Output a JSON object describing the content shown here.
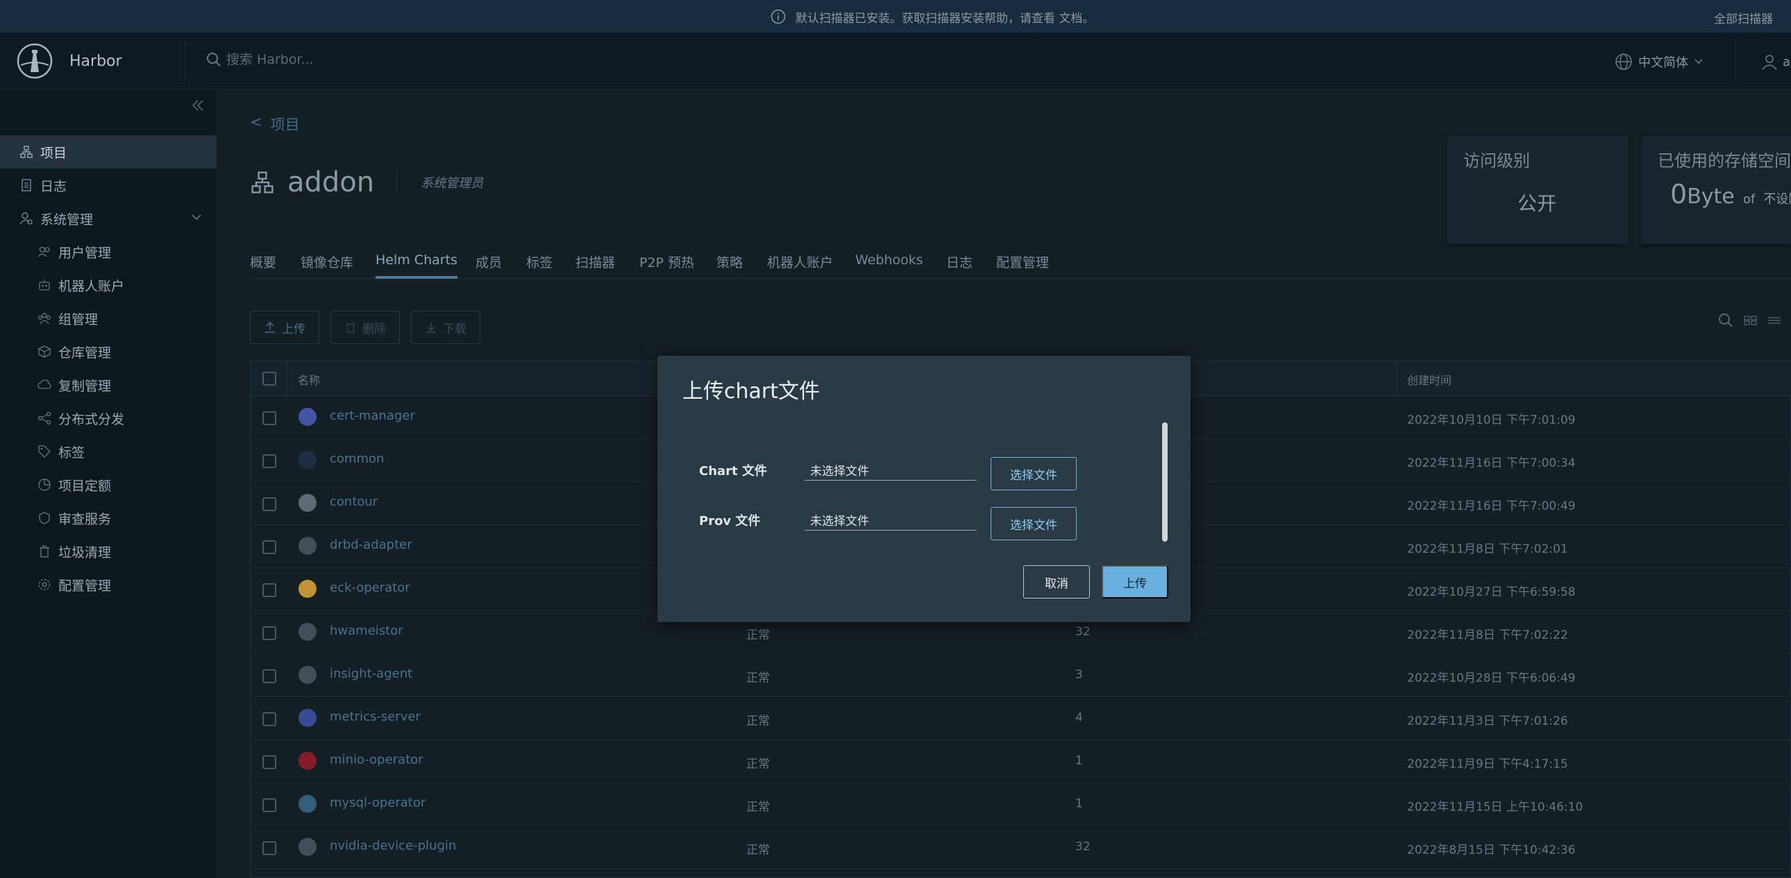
{
  "banner": {
    "message": "默认扫描器已安装。获取扫描器安装帮助，请查看 文档。",
    "action": "全部扫描器"
  },
  "header": {
    "brand": "Harbor",
    "search_placeholder": "搜索 Harbor...",
    "language": "中文简体",
    "user": "ad"
  },
  "sidebar": {
    "items": [
      {
        "label": "项目",
        "icon": "project-icon"
      },
      {
        "label": "日志",
        "icon": "log-icon"
      },
      {
        "label": "系统管理",
        "icon": "admin-icon"
      },
      {
        "label": "用户管理",
        "icon": "users-icon"
      },
      {
        "label": "机器人账户",
        "icon": "robot-icon"
      },
      {
        "label": "组管理",
        "icon": "group-icon"
      },
      {
        "label": "仓库管理",
        "icon": "registry-icon"
      },
      {
        "label": "复制管理",
        "icon": "replication-icon"
      },
      {
        "label": "分布式分发",
        "icon": "distribution-icon"
      },
      {
        "label": "标签",
        "icon": "tag-icon"
      },
      {
        "label": "项目定额",
        "icon": "quota-icon"
      },
      {
        "label": "审查服务",
        "icon": "interrogation-icon"
      },
      {
        "label": "垃圾清理",
        "icon": "trash-icon"
      },
      {
        "label": "配置管理",
        "icon": "config-icon"
      }
    ]
  },
  "breadcrumb": {
    "back": "<",
    "label": "项目"
  },
  "project": {
    "name": "addon",
    "role": "系统管理员"
  },
  "cards": {
    "access": {
      "title": "访问级别",
      "value": "公开"
    },
    "storage": {
      "title": "已使用的存储空间",
      "value": "0",
      "unit": "Byte",
      "of": "of",
      "limit": "不设限"
    }
  },
  "tabs": [
    "概要",
    "镜像仓库",
    "Helm Charts",
    "成员",
    "标签",
    "扫描器",
    "P2P 预热",
    "策略",
    "机器人账户",
    "Webhooks",
    "日志",
    "配置管理"
  ],
  "toolbar": {
    "upload": "上传",
    "delete": "删除",
    "download": "下载"
  },
  "table": {
    "headers": {
      "name": "名称",
      "created": "创建时间"
    },
    "rows": [
      {
        "name": "cert-manager",
        "status": "",
        "count": "",
        "time": "2022年10月10日 下午7:01:09"
      },
      {
        "name": "common",
        "status": "",
        "count": "",
        "time": "2022年11月16日 下午7:00:34"
      },
      {
        "name": "contour",
        "status": "",
        "count": "",
        "time": "2022年11月16日 下午7:00:49"
      },
      {
        "name": "drbd-adapter",
        "status": "",
        "count": "",
        "time": "2022年11月8日 下午7:02:01"
      },
      {
        "name": "eck-operator",
        "status": "",
        "count": "",
        "time": "2022年10月27日 下午6:59:58"
      },
      {
        "name": "hwameistor",
        "status": "正常",
        "count": "32",
        "time": "2022年11月8日 下午7:02:22"
      },
      {
        "name": "insight-agent",
        "status": "正常",
        "count": "3",
        "time": "2022年10月28日 下午6:06:49"
      },
      {
        "name": "metrics-server",
        "status": "正常",
        "count": "4",
        "time": "2022年11月3日 下午7:01:26"
      },
      {
        "name": "minio-operator",
        "status": "正常",
        "count": "1",
        "time": "2022年11月9日 下午4:17:15"
      },
      {
        "name": "mysql-operator",
        "status": "正常",
        "count": "1",
        "time": "2022年11月15日 上午10:46:10"
      },
      {
        "name": "nvidia-device-plugin",
        "status": "正常",
        "count": "32",
        "time": "2022年8月15日 下午10:42:36"
      }
    ]
  },
  "modal": {
    "title": "上传chart文件",
    "chart_label": "Chart 文件",
    "chart_value": "未选择文件",
    "prov_label": "Prov 文件",
    "prov_value": "未选择文件",
    "pick_label": "选择文件",
    "cancel": "取消",
    "upload": "上传"
  }
}
